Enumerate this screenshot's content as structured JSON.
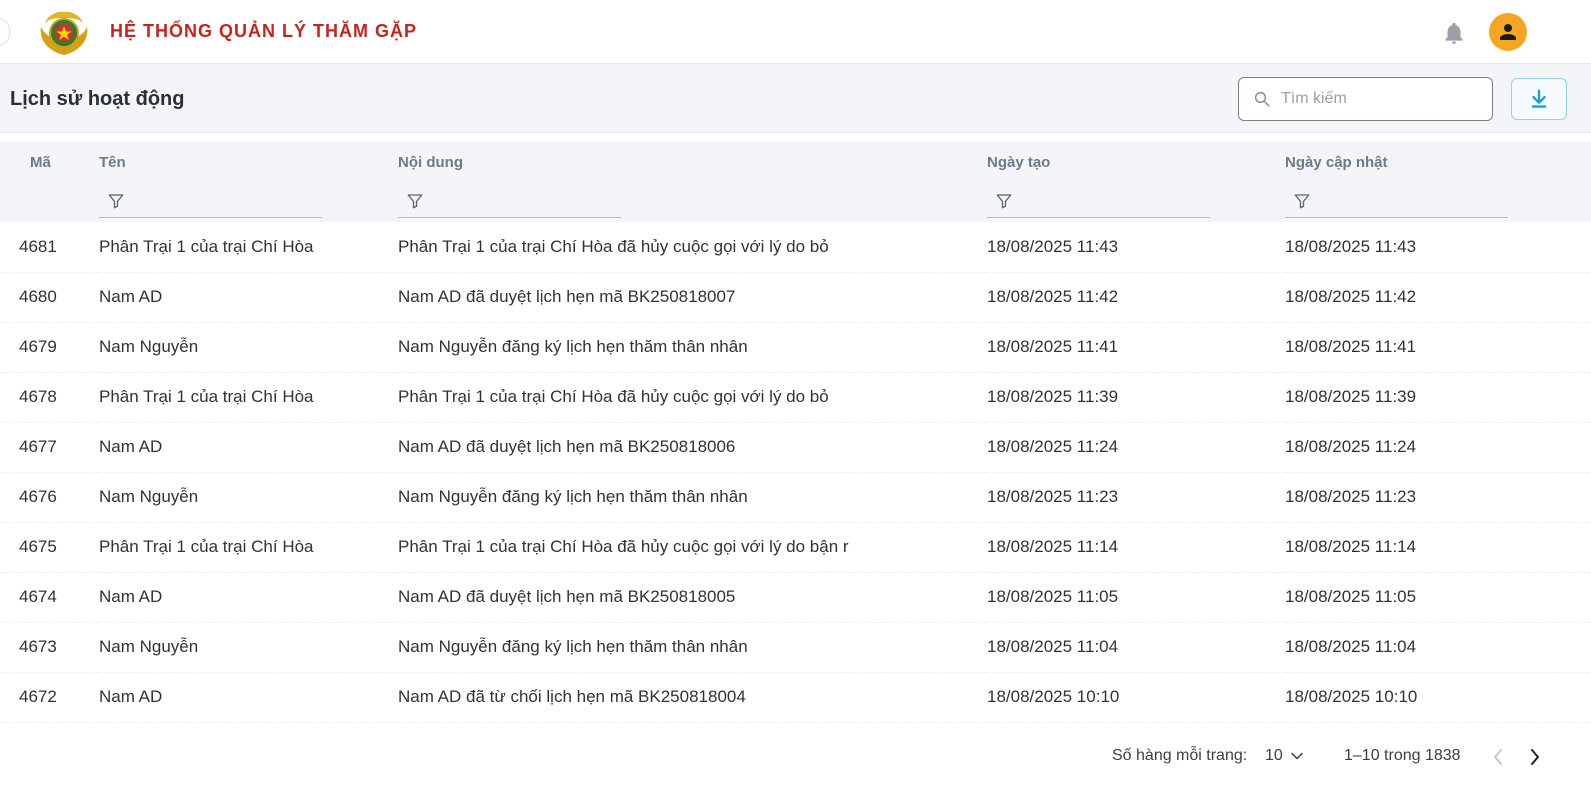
{
  "header": {
    "app_title": "HỆ THỐNG QUẢN LÝ THĂM GẶP",
    "logo_icon": "police-emblem-logo",
    "bell_icon": "bell-icon",
    "avatar_icon": "user-avatar-icon",
    "avatar_color": "#f5a623",
    "title_color": "#c8231d"
  },
  "toolbar": {
    "page_title": "Lịch sử hoạt động",
    "search_placeholder": "Tìm kiếm",
    "search_value": "",
    "download_icon": "download-icon"
  },
  "table": {
    "columns": [
      "Mã",
      "Tên",
      "Nội dung",
      "Ngày tạo",
      "Ngày cập nhật"
    ],
    "rows": [
      {
        "id": "4681",
        "name": "Phân Trại 1 của trại Chí Hòa",
        "content": "Phân Trại 1 của trại Chí Hòa đã hủy cuộc gọi với lý do bỏ",
        "created": "18/08/2025 11:43",
        "updated": "18/08/2025 11:43"
      },
      {
        "id": "4680",
        "name": "Nam AD",
        "content": "Nam AD đã duyệt lịch hẹn mã BK250818007",
        "created": "18/08/2025 11:42",
        "updated": "18/08/2025 11:42"
      },
      {
        "id": "4679",
        "name": "Nam Nguyễn",
        "content": "Nam Nguyễn đăng ký lịch hẹn thăm thân nhân",
        "created": "18/08/2025 11:41",
        "updated": "18/08/2025 11:41"
      },
      {
        "id": "4678",
        "name": "Phân Trại 1 của trại Chí Hòa",
        "content": "Phân Trại 1 của trại Chí Hòa đã hủy cuộc gọi với lý do bỏ",
        "created": "18/08/2025 11:39",
        "updated": "18/08/2025 11:39"
      },
      {
        "id": "4677",
        "name": "Nam AD",
        "content": "Nam AD đã duyệt lịch hẹn mã BK250818006",
        "created": "18/08/2025 11:24",
        "updated": "18/08/2025 11:24"
      },
      {
        "id": "4676",
        "name": "Nam Nguyễn",
        "content": "Nam Nguyễn đăng ký lịch hẹn thăm thân nhân",
        "created": "18/08/2025 11:23",
        "updated": "18/08/2025 11:23"
      },
      {
        "id": "4675",
        "name": "Phân Trại 1 của trại Chí Hòa",
        "content": "Phân Trại 1 của trại Chí Hòa đã hủy cuộc gọi với lý do bận r",
        "created": "18/08/2025 11:14",
        "updated": "18/08/2025 11:14"
      },
      {
        "id": "4674",
        "name": "Nam AD",
        "content": "Nam AD đã duyệt lịch hẹn mã BK250818005",
        "created": "18/08/2025 11:05",
        "updated": "18/08/2025 11:05"
      },
      {
        "id": "4673",
        "name": "Nam Nguyễn",
        "content": "Nam Nguyễn đăng ký lịch hẹn thăm thân nhân",
        "created": "18/08/2025 11:04",
        "updated": "18/08/2025 11:04"
      },
      {
        "id": "4672",
        "name": "Nam AD",
        "content": "Nam AD đã từ chối lịch hẹn mã BK250818004",
        "created": "18/08/2025 10:10",
        "updated": "18/08/2025 10:10"
      }
    ]
  },
  "pagination": {
    "rows_per_page_label": "Số hàng mỗi trang:",
    "rows_per_page_value": "10",
    "range_label": "1–10 trong 1838",
    "prev_icon": "chevron-left-icon",
    "next_icon": "chevron-right-icon"
  }
}
